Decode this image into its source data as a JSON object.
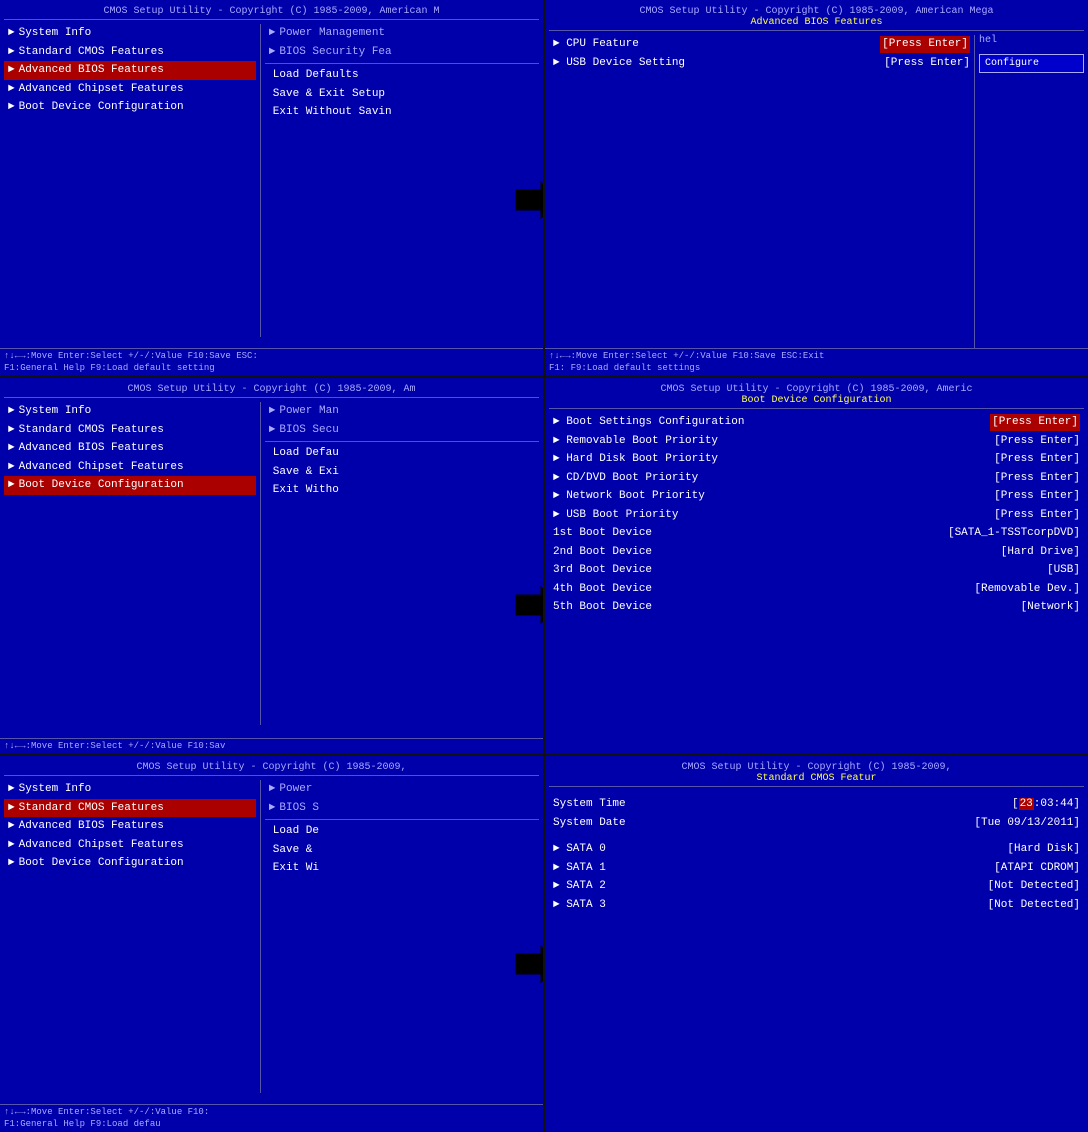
{
  "panels": {
    "panel1": {
      "header": "CMOS Setup Utility - Copyright (C) 1985-2009, American M",
      "menu_items": [
        {
          "label": "System Info",
          "selected": false,
          "arrow": true
        },
        {
          "label": "Standard CMOS Features",
          "selected": false,
          "arrow": true
        },
        {
          "label": "Advanced BIOS Features",
          "selected": true,
          "arrow": true
        },
        {
          "label": "Advanced Chipset Features",
          "selected": false,
          "arrow": true
        },
        {
          "label": "Boot Device Configuration",
          "selected": false,
          "arrow": true
        }
      ],
      "right_items": [
        {
          "label": "Power Management",
          "arrow": true
        },
        {
          "label": "BIOS Security Fea",
          "arrow": true
        },
        {
          "label": "Load Defaults",
          "arrow": false
        },
        {
          "label": "Save & Exit Setup",
          "arrow": false
        },
        {
          "label": "Exit Without Savin",
          "arrow": false
        }
      ],
      "status1": "↑↓←→:Move  Enter:Select  +/-/:Value  F10:Save  ESC:",
      "status2": "F1:General Help          F9:Load default setting"
    },
    "panel2": {
      "header_line1": "CMOS Setup Utility - Copyright (C) 1985-2009, American Mega",
      "header_line2": "Advanced BIOS Features",
      "bios_rows": [
        {
          "label": "CPU Feature",
          "value": "[Press Enter]",
          "highlighted": true,
          "arrow": true
        },
        {
          "label": "USB Device Setting",
          "value": "[Press Enter]",
          "highlighted": false,
          "arrow": true
        }
      ],
      "help_label": "hel",
      "configure_label": "Configure",
      "status1": "↑↓←→:Move  Enter:Select  +/-/:Value  F10:Save  ESC:Exit",
      "status2": "F1:                      F9:Load default settings"
    },
    "panel3": {
      "header": "CMOS Setup Utility - Copyright (C) 1985-2009, Am",
      "menu_items": [
        {
          "label": "System Info",
          "selected": false,
          "arrow": true
        },
        {
          "label": "Standard CMOS Features",
          "selected": false,
          "arrow": true
        },
        {
          "label": "Advanced BIOS Features",
          "selected": false,
          "arrow": true
        },
        {
          "label": "Advanced Chipset Features",
          "selected": false,
          "arrow": true
        },
        {
          "label": "Boot Device Configuration",
          "selected": true,
          "arrow": true
        }
      ],
      "right_items": [
        {
          "label": "Power Man",
          "arrow": true
        },
        {
          "label": "BIOS Secu",
          "arrow": true
        },
        {
          "label": "Load Defau",
          "arrow": false
        },
        {
          "label": "Save & Exi",
          "arrow": false
        },
        {
          "label": "Exit Witho",
          "arrow": false
        }
      ],
      "status1": "↑↓←→:Move  Enter:Select  +/-/:Value  F10:Sav"
    },
    "panel4": {
      "header_line1": "CMOS Setup Utility - Copyright (C) 1985-2009, Americ",
      "header_line2": "Boot Device Configuration",
      "bios_rows": [
        {
          "label": "Boot Settings Configuration",
          "value": "[Press Enter]",
          "highlighted": true,
          "arrow": true
        },
        {
          "label": "Removable Boot Priority",
          "value": "[Press Enter]",
          "highlighted": false,
          "arrow": true
        },
        {
          "label": "Hard Disk Boot Priority",
          "value": "[Press Enter]",
          "highlighted": false,
          "arrow": true
        },
        {
          "label": "CD/DVD Boot Priority",
          "value": "[Press Enter]",
          "highlighted": false,
          "arrow": true
        },
        {
          "label": "Network Boot Priority",
          "value": "[Press Enter]",
          "highlighted": false,
          "arrow": true
        },
        {
          "label": "USB Boot Priority",
          "value": "[Press Enter]",
          "highlighted": false,
          "arrow": true
        },
        {
          "label": "1st Boot Device",
          "value": "[SATA_1-TSSTcorpDVD]",
          "highlighted": false,
          "arrow": false
        },
        {
          "label": "2nd Boot Device",
          "value": "[Hard Drive]",
          "highlighted": false,
          "arrow": false
        },
        {
          "label": "3rd Boot Device",
          "value": "[USB]",
          "highlighted": false,
          "arrow": false
        },
        {
          "label": "4th Boot Device",
          "value": "[Removable Dev.]",
          "highlighted": false,
          "arrow": false
        },
        {
          "label": "5th Boot Device",
          "value": "[Network]",
          "highlighted": false,
          "arrow": false
        }
      ]
    },
    "panel5": {
      "header": "CMOS Setup Utility - Copyright (C) 1985-2009,",
      "menu_items": [
        {
          "label": "System Info",
          "selected": false,
          "arrow": true
        },
        {
          "label": "Standard CMOS Features",
          "selected": true,
          "arrow": true
        },
        {
          "label": "Advanced BIOS Features",
          "selected": false,
          "arrow": true
        },
        {
          "label": "Advanced Chipset Features",
          "selected": false,
          "arrow": true
        },
        {
          "label": "Boot Device Configuration",
          "selected": false,
          "arrow": true
        }
      ],
      "right_items": [
        {
          "label": "Power",
          "arrow": true
        },
        {
          "label": "BIOS S",
          "arrow": true
        },
        {
          "label": "Load De",
          "arrow": false
        },
        {
          "label": "Save &",
          "arrow": false
        },
        {
          "label": "Exit Wi",
          "arrow": false
        }
      ],
      "status1": "↑↓←→:Move  Enter:Select  +/-/:Value  F10:",
      "status2": "F1:General Help          F9:Load defau"
    },
    "panel6": {
      "header_line1": "CMOS Setup Utility - Copyright (C) 1985-2009,",
      "header_line2": "Standard CMOS Featur",
      "bios_rows": [
        {
          "label": "System Time",
          "value": "[23:03:44]",
          "value_part_red": "23",
          "highlighted": false,
          "arrow": false
        },
        {
          "label": "System Date",
          "value": "[Tue 09/13/2011]",
          "highlighted": false,
          "arrow": false
        },
        {
          "label": "SATA 0",
          "value": "[Hard Disk]",
          "highlighted": false,
          "arrow": true
        },
        {
          "label": "SATA 1",
          "value": "[ATAPI CDROM]",
          "highlighted": false,
          "arrow": true
        },
        {
          "label": "SATA 2",
          "value": "[Not Detected]",
          "highlighted": false,
          "arrow": true
        },
        {
          "label": "SATA 3",
          "value": "[Not Detected]",
          "highlighted": false,
          "arrow": true
        }
      ]
    }
  },
  "arrows": {
    "arrow1": {
      "direction": "right",
      "label": "→"
    },
    "arrow2": {
      "direction": "right",
      "label": "→"
    },
    "arrow3": {
      "direction": "right",
      "label": "→"
    }
  }
}
